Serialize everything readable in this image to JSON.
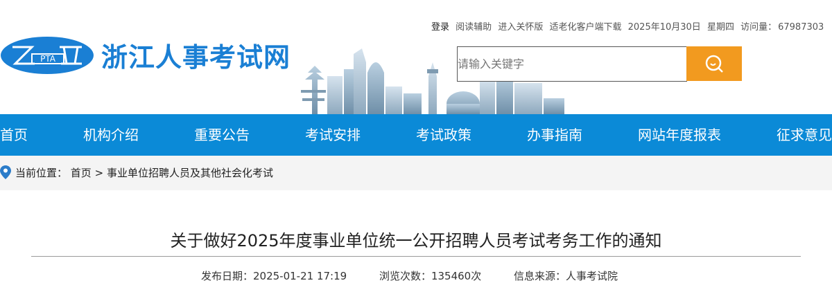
{
  "header": {
    "site_name": "浙江人事考试网",
    "logo_text": "PTA",
    "top_links": {
      "login": "登录",
      "reading_assist": "阅读辅助",
      "care_version": "进入关怀版",
      "elderly_client": "适老化客户端下载",
      "date": "2025年10月30日",
      "weekday": "星期四",
      "visits_label": "访问量：",
      "visits_value": "67987303"
    },
    "search": {
      "placeholder": "请输入关键字",
      "icon": "search-icon",
      "button_color": "#f29a1f"
    }
  },
  "nav": {
    "color": "#0b8ad7",
    "items": [
      {
        "label": "首页"
      },
      {
        "label": "机构介绍"
      },
      {
        "label": "重要公告"
      },
      {
        "label": "考试安排"
      },
      {
        "label": "考试政策"
      },
      {
        "label": "办事指南"
      },
      {
        "label": "网站年度报表"
      },
      {
        "label": "征求意见"
      }
    ]
  },
  "breadcrumb": {
    "prefix": "当前位置：",
    "home": "首页",
    "separator": ">",
    "current": "事业单位招聘人员及其他社会化考试"
  },
  "article": {
    "title": "关于做好2025年度事业单位统一公开招聘人员考试考务工作的通知",
    "publish_date": "发布日期：2025-01-21 17:19",
    "views": "浏览次数：135460次",
    "source": "信息来源：人事考试院"
  }
}
